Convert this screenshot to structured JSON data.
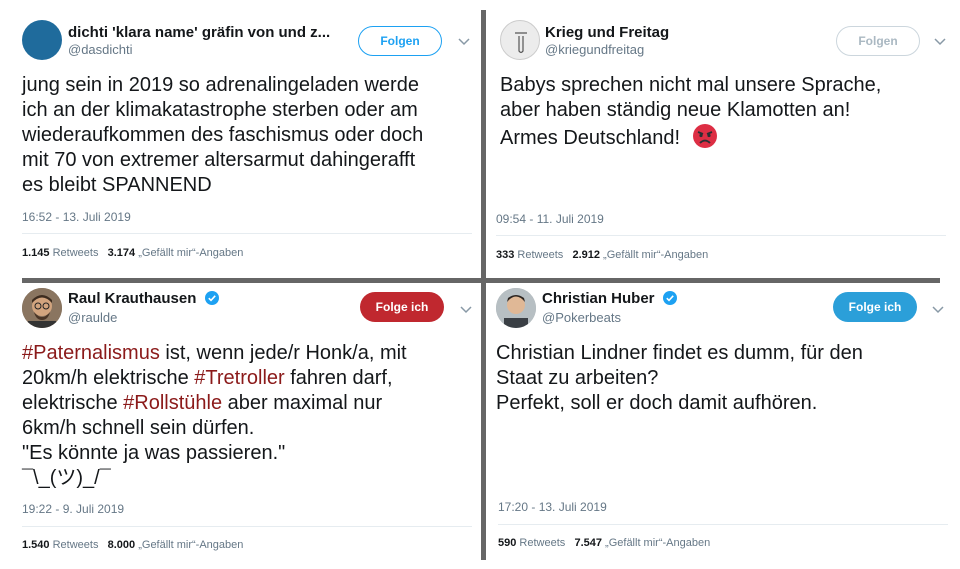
{
  "tweets": [
    {
      "name": "dichti 'klara name' gräfin von und z...",
      "handle": "@dasdichti",
      "follow_label": "Folgen",
      "lines": [
        "jung sein in 2019 so adrenalingeladen werde",
        "ich an der klimakatastrophe sterben oder am",
        "wiederaufkommen des faschismus oder doch",
        "mit 70 von extremer altersarmut dahingerafft",
        "es bleibt SPANNEND"
      ],
      "time": "16:52 - 13. Juli 2019",
      "retweets_count": "1.145",
      "retweets_label": "Retweets",
      "likes_count": "3.174",
      "likes_label": "„Gefällt mir“-Angaben"
    },
    {
      "name": "Krieg und Freitag",
      "handle": "@kriegundfreitag",
      "follow_label": "Folgen",
      "lines": [
        "Babys sprechen nicht mal unsere Sprache,",
        "aber haben ständig neue Klamotten an!",
        "Armes Deutschland!"
      ],
      "time": "09:54 - 11. Juli 2019",
      "retweets_count": "333",
      "retweets_label": "Retweets",
      "likes_count": "2.912",
      "likes_label": "„Gefällt mir“-Angaben"
    },
    {
      "name": "Raul Krauthausen",
      "handle": "@raulde",
      "follow_label": "Folge ich",
      "hashtags": [
        "#Paternalismus",
        "#Tretroller",
        "#Rollstühle"
      ],
      "line1_rest": " ist, wenn jede/r Honk/a, mit",
      "line2_pre": "20km/h elektrische ",
      "line2_post": " fahren darf,",
      "line3_pre": "elektrische ",
      "line3_post": " aber maximal nur",
      "line4": "6km/h schnell sein dürfen.",
      "line5": "\"Es könnte ja was passieren.\"",
      "line6": "¯\\_(ツ)_/¯",
      "time": "19:22 - 9. Juli 2019",
      "retweets_count": "1.540",
      "retweets_label": "Retweets",
      "likes_count": "8.000",
      "likes_label": "„Gefällt mir“-Angaben"
    },
    {
      "name": "Christian Huber",
      "handle": "@Pokerbeats",
      "follow_label": "Folge ich",
      "lines": [
        "Christian Lindner findet es dumm, für den",
        "Staat zu arbeiten?",
        "Perfekt, soll er doch damit aufhören."
      ],
      "time": "17:20 - 13. Juli 2019",
      "retweets_count": "590",
      "retweets_label": "Retweets",
      "likes_count": "7.547",
      "likes_label": "„Gefällt mir“-Angaben"
    }
  ],
  "colors": {
    "follow_outline": "#1da1f2",
    "following_red": "#c0282f",
    "following_blue": "#2b9fd9",
    "hashtag": "#8b1a1a",
    "verified": "#1da1f2"
  }
}
